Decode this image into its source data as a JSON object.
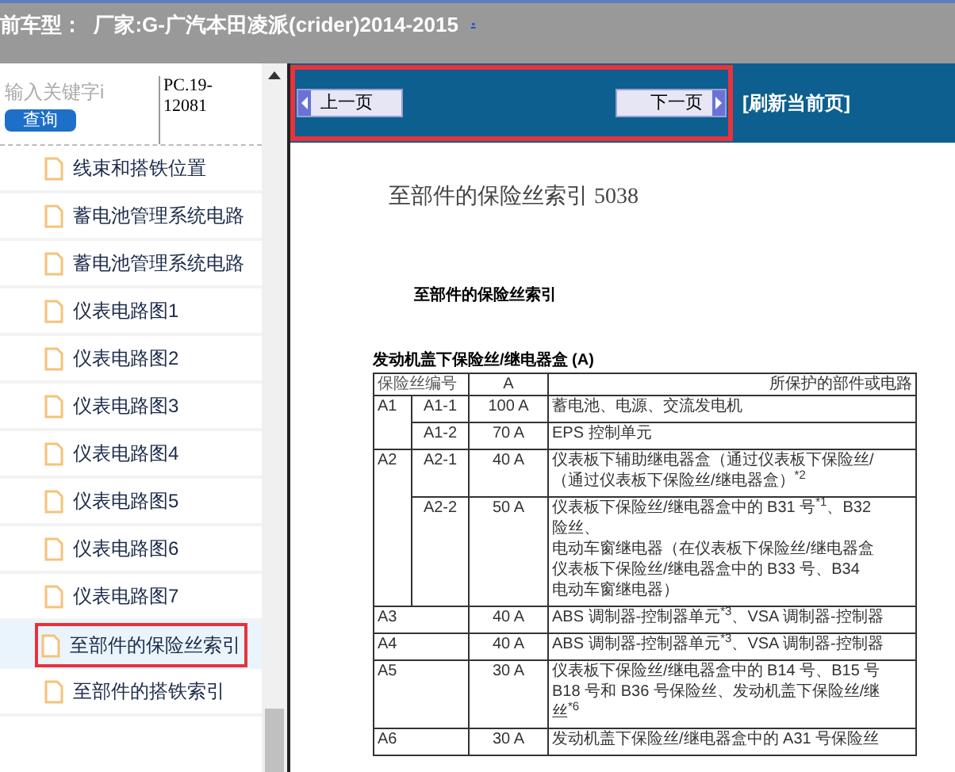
{
  "header": {
    "title": "前车型：  厂家:G-广汽本田凌派(crider)2014-2015",
    "link": "."
  },
  "sidebar": {
    "search": {
      "placeholder": "输入关键字i"
    },
    "query_button": "查询",
    "code": "PC.19-12081",
    "items": [
      {
        "label": "线束和搭铁位置",
        "selected": false
      },
      {
        "label": "蓄电池管理系统电路",
        "selected": false
      },
      {
        "label": "蓄电池管理系统电路",
        "selected": false
      },
      {
        "label": "仪表电路图1",
        "selected": false
      },
      {
        "label": "仪表电路图2",
        "selected": false
      },
      {
        "label": "仪表电路图3",
        "selected": false
      },
      {
        "label": "仪表电路图4",
        "selected": false
      },
      {
        "label": "仪表电路图5",
        "selected": false
      },
      {
        "label": "仪表电路图6",
        "selected": false
      },
      {
        "label": "仪表电路图7",
        "selected": false
      },
      {
        "label": "至部件的保险丝索引",
        "selected": true
      },
      {
        "label": "至部件的搭铁索引",
        "selected": false
      }
    ]
  },
  "nav": {
    "prev": "上一页",
    "next": "下一页",
    "refresh": "[刷新当前页]"
  },
  "document": {
    "page_title": "至部件的保险丝索引 5038",
    "heading": "至部件的保险丝索引",
    "section": "发动机盖下保险丝/继电器盒 (A)",
    "table": {
      "columns": [
        "保险丝编号",
        "A",
        "所保护的部件或电路"
      ],
      "groups": [
        {
          "fuse": "A1",
          "rows": [
            {
              "sub": "A1-1",
              "amps": "100 A",
              "lines": [
                "蓄电池、电源、交流发电机"
              ]
            },
            {
              "sub": "A1-2",
              "amps": "70 A",
              "lines": [
                "EPS 控制单元"
              ]
            }
          ]
        },
        {
          "fuse": "A2",
          "rows": [
            {
              "sub": "A2-1",
              "amps": "40 A",
              "lines": [
                "仪表板下辅助继电器盒（通过仪表板下保险丝/",
                "（通过仪表板下保险丝/继电器盒）$^{*2}$"
              ]
            },
            {
              "sub": "A2-2",
              "amps": "50 A",
              "lines": [
                "仪表板下保险丝/继电器盒中的 B31 号$^{*1}$、B32",
                "险丝、",
                "电动车窗继电器（在仪表板下保险丝/继电器盒",
                "仪表板下保险丝/继电器盒中的 B33 号、B34",
                "电动车窗继电器）"
              ]
            }
          ]
        },
        {
          "fuse": "A3",
          "rows": [
            {
              "amps": "40 A",
              "lines": [
                "ABS 调制器-控制器单元$^{*3}$、VSA 调制器-控制器"
              ]
            }
          ]
        },
        {
          "fuse": "A4",
          "rows": [
            {
              "amps": "40 A",
              "lines": [
                "ABS 调制器-控制器单元$^{*3}$、VSA 调制器-控制器"
              ]
            }
          ]
        },
        {
          "fuse": "A5",
          "rows": [
            {
              "amps": "30 A",
              "lines": [
                "仪表板下保险丝/继电器盒中的 B14 号、B15 号",
                "B18 号和 B36 号保险丝、发动机盖下保险丝/继",
                "丝$^{*6}$"
              ]
            }
          ]
        },
        {
          "fuse": "A6",
          "rows": [
            {
              "amps": "30 A",
              "lines": [
                "发动机盖下保险丝/继电器盒中的 A31 号保险丝"
              ]
            }
          ]
        }
      ]
    }
  }
}
